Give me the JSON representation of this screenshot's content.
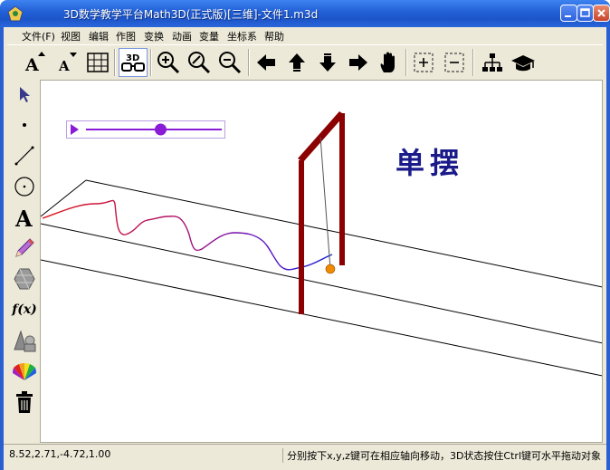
{
  "window": {
    "title": "3D数学教学平台Math3D(正式版)[三维]-文件1.m3d",
    "icon": "app-logo-icon"
  },
  "menu": {
    "items": [
      "文件(F)",
      "视图",
      "编辑",
      "作图",
      "变换",
      "动画",
      "变量",
      "坐标系",
      "帮助"
    ]
  },
  "toolbar": {
    "tools": [
      {
        "name": "font-increase-icon",
        "label": "A"
      },
      {
        "name": "font-decrease-icon",
        "label": "A"
      },
      {
        "name": "grid-icon"
      },
      {
        "name": "3d-glasses-icon",
        "label": "3D"
      },
      {
        "name": "zoom-in-icon"
      },
      {
        "name": "zoom-fit-icon"
      },
      {
        "name": "zoom-out-icon"
      },
      {
        "name": "arrow-left-icon"
      },
      {
        "name": "arrow-up-icon"
      },
      {
        "name": "arrow-down-icon"
      },
      {
        "name": "arrow-right-icon"
      },
      {
        "name": "hand-pan-icon"
      },
      {
        "name": "box-plus-icon"
      },
      {
        "name": "box-minus-icon"
      },
      {
        "name": "hierarchy-icon"
      },
      {
        "name": "graduation-cap-icon"
      }
    ]
  },
  "side_tools": [
    {
      "name": "select-arrow-icon"
    },
    {
      "name": "point-tool-icon"
    },
    {
      "name": "line-tool-icon"
    },
    {
      "name": "circle-tool-icon"
    },
    {
      "name": "text-tool-icon",
      "label": "A"
    },
    {
      "name": "pencil-tool-icon"
    },
    {
      "name": "polygon-tool-icon"
    },
    {
      "name": "function-tool-icon",
      "label": "f(x)"
    },
    {
      "name": "solid-tool-icon"
    },
    {
      "name": "color-palette-icon"
    },
    {
      "name": "trash-icon"
    }
  ],
  "canvas": {
    "heading": "单摆",
    "slider_value": 0.55
  },
  "status": {
    "coords": "8.52,2.71,-4.72,1.00",
    "hint": "分别按下x,y,z键可在相应轴向移动，3D状态按住Ctrl键可水平拖动对象"
  },
  "colors": {
    "title_bar": "#2462d8",
    "pendulum_frame": "#8b0000",
    "heading": "#1a1a8a",
    "slider": "#8a1bd6",
    "bob": "#f08a00"
  }
}
